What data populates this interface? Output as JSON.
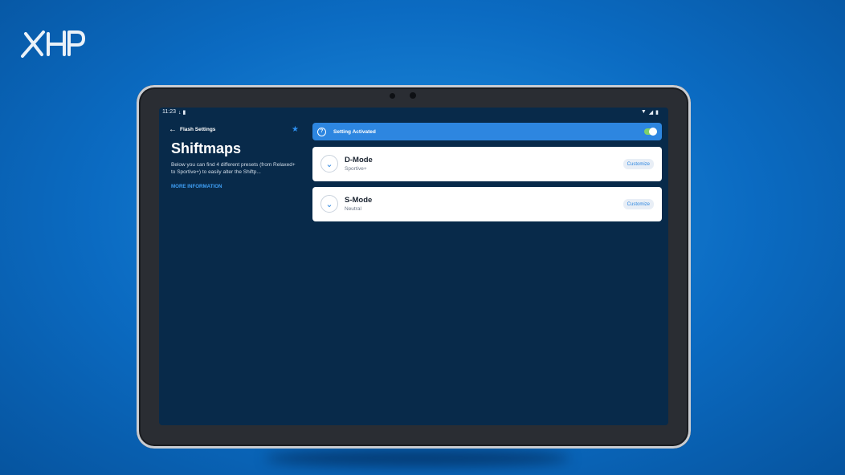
{
  "brand": {
    "logo_text": "XHP"
  },
  "status_bar": {
    "time": "11:23"
  },
  "header": {
    "back_label": "Flash Settings"
  },
  "page": {
    "title": "Shiftmaps",
    "description": "Below you can find 4 different presets (from Relaxed+ to Sportive+) to easily alter the Shiftp...",
    "more_info": "MORE INFORMATION"
  },
  "settings": {
    "activated_label": "Setting Activated",
    "toggle_on": true
  },
  "modes": [
    {
      "name": "D-Mode",
      "preset": "Sportive+",
      "action": "Customize"
    },
    {
      "name": "S-Mode",
      "preset": "Neutral",
      "action": "Customize"
    }
  ],
  "colors": {
    "background": "#0b6bc2",
    "screen": "#082a4a",
    "accent": "#2d86e0",
    "toggle": "#7fd06a"
  }
}
